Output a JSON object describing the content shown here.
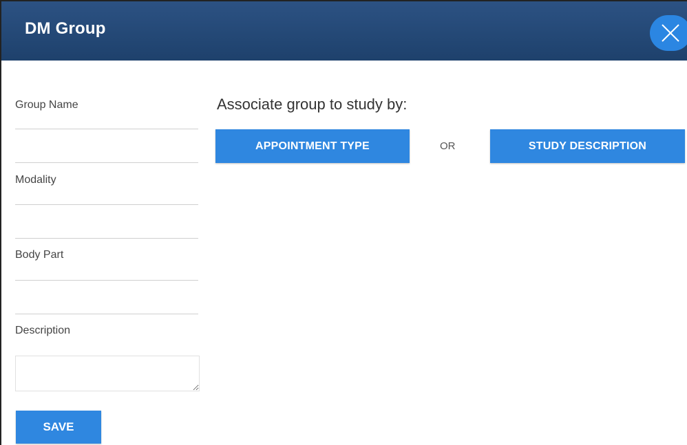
{
  "dialog": {
    "title": "DM Group",
    "close_icon": "close-icon"
  },
  "form": {
    "group_name_label": "Group Name",
    "group_name_value": "",
    "modality_label": "Modality",
    "modality_value": "",
    "body_part_label": "Body Part",
    "body_part_value": "",
    "description_label": "Description",
    "description_value": "",
    "save_label": "SAVE"
  },
  "associate": {
    "title": "Associate group to study by:",
    "appointment_type_label": "APPOINTMENT TYPE",
    "or_label": "OR",
    "study_description_label": "STUDY DESCRIPTION"
  },
  "colors": {
    "header": "#1f426e",
    "accent": "#2f87e0"
  }
}
